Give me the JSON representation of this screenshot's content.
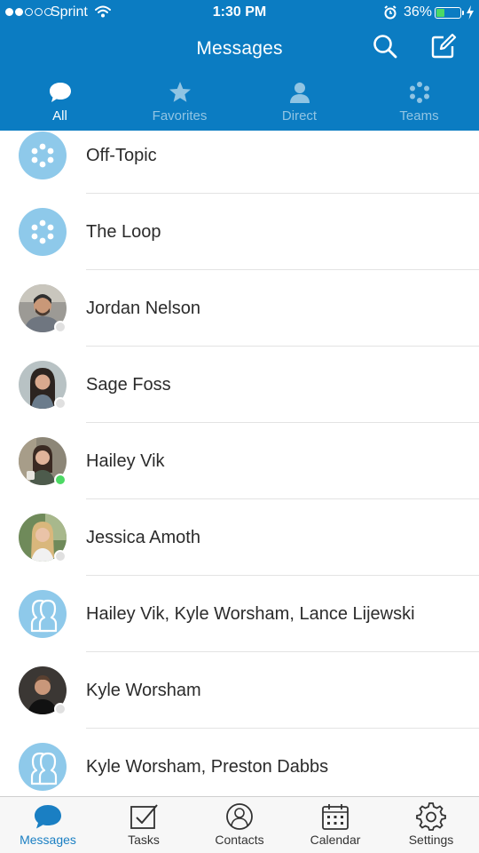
{
  "status_bar": {
    "carrier": "Sprint",
    "time": "1:30 PM",
    "battery": "36%",
    "battery_level": 0.36
  },
  "header": {
    "title": "Messages",
    "search_icon": "search-icon",
    "compose_icon": "compose-icon"
  },
  "tabs": [
    {
      "label": "All",
      "icon": "chat-bubble-icon",
      "active": true
    },
    {
      "label": "Favorites",
      "icon": "star-icon",
      "active": false
    },
    {
      "label": "Direct",
      "icon": "person-icon",
      "active": false
    },
    {
      "label": "Teams",
      "icon": "team-dots-icon",
      "active": false
    }
  ],
  "conversations": [
    {
      "name": "Off-Topic",
      "avatar": "team-avatar"
    },
    {
      "name": "The Loop",
      "avatar": "team-avatar"
    },
    {
      "name": "Jordan Nelson",
      "avatar": "user-photo",
      "presence": "offline"
    },
    {
      "name": "Sage Foss",
      "avatar": "user-photo",
      "presence": "offline"
    },
    {
      "name": "Hailey Vik",
      "avatar": "user-photo",
      "presence": "online"
    },
    {
      "name": "Jessica Amoth",
      "avatar": "user-photo",
      "presence": "offline"
    },
    {
      "name": "Hailey Vik, Kyle Worsham, Lance Lijewski",
      "avatar": "group-avatar"
    },
    {
      "name": "Kyle Worsham",
      "avatar": "user-photo",
      "presence": "offline"
    },
    {
      "name": "Kyle Worsham, Preston Dabbs",
      "avatar": "group-avatar"
    }
  ],
  "bottom_tabs": [
    {
      "label": "Messages",
      "icon": "messages-icon",
      "active": true
    },
    {
      "label": "Tasks",
      "icon": "tasks-icon",
      "active": false
    },
    {
      "label": "Contacts",
      "icon": "contacts-icon",
      "active": false
    },
    {
      "label": "Calendar",
      "icon": "calendar-icon",
      "active": false
    },
    {
      "label": "Settings",
      "icon": "settings-icon",
      "active": false
    }
  ],
  "colors": {
    "header": "#0b7cc2",
    "accent": "#1a7fc3",
    "team_avatar": "#8ec9ea",
    "online": "#4cd964",
    "offline": "#e0e0e0"
  }
}
